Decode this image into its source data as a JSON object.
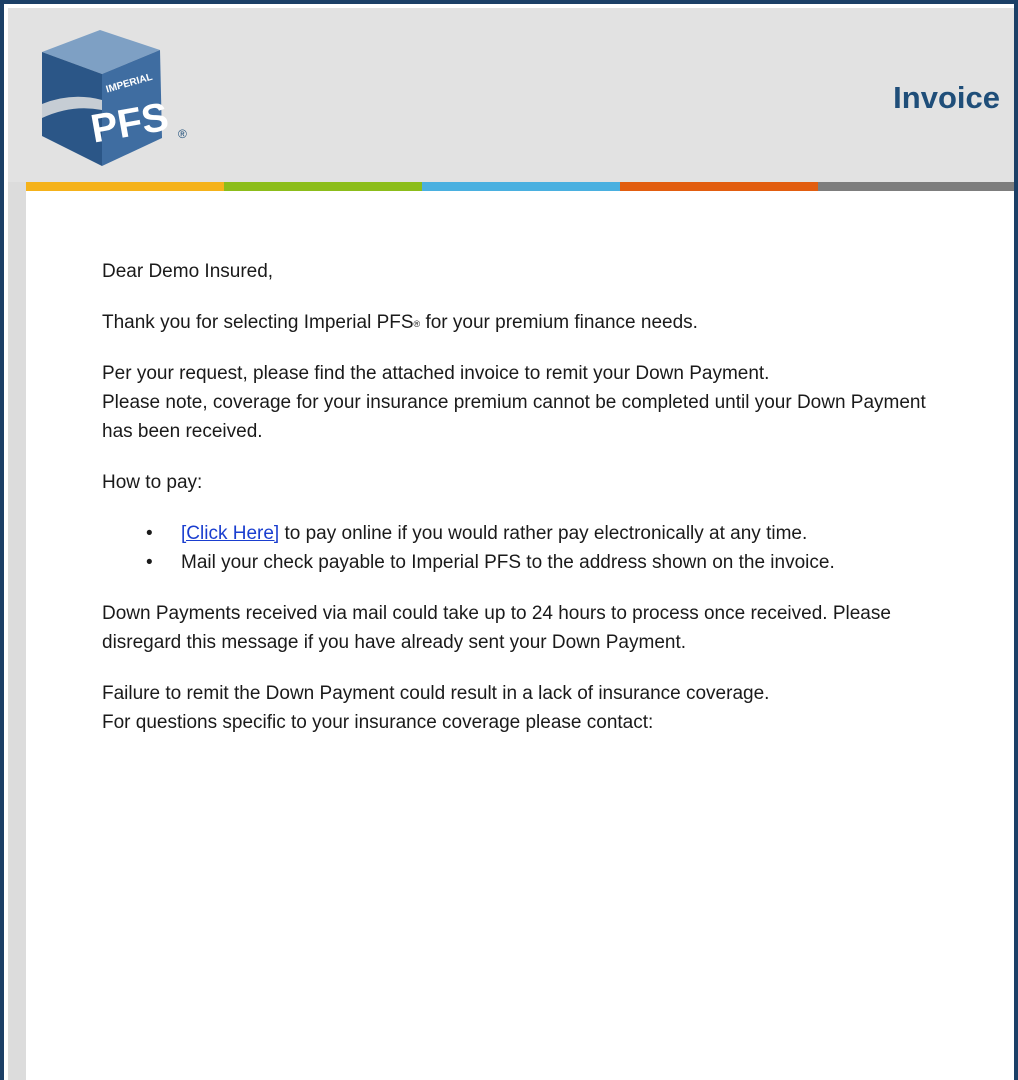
{
  "header": {
    "logo": {
      "top_text": "IMPERIAL",
      "main_text": "PFS",
      "registered_mark": "®"
    },
    "title": "Invoice"
  },
  "colors": {
    "frame_border": "#1b3f66",
    "header_bg": "#e2e2e2",
    "title": "#1f4e79",
    "link": "#1a3ecf",
    "stripe": [
      "#f5b21a",
      "#8cbd1a",
      "#4ab0e0",
      "#e25d0f",
      "#7d7d7d"
    ]
  },
  "email": {
    "greeting": "Dear Demo Insured,",
    "thanks_before": "Thank you for selecting Imperial PFS",
    "thanks_mark": "®",
    "thanks_after": " for your premium finance needs.",
    "request_line": "Per your request, please find the attached invoice to remit your Down Payment.",
    "note_line": "Please note, coverage for your insurance premium cannot be completed until your Down Payment has been received.",
    "how_to_pay": "How to pay:",
    "pay_options": [
      {
        "link_text": "[Click Here]",
        "text": " to pay online if you would rather pay electronically at any time."
      },
      {
        "link_text": "",
        "text": "Mail your check payable to Imperial PFS to the address shown on the invoice."
      }
    ],
    "mail_processing": "Down Payments received via mail could take up to 24 hours to process once received. Please disregard this message if you have already sent your Down Payment.",
    "failure_warning": "Failure to remit the Down Payment could result in a lack of insurance coverage.",
    "contact_prompt": "For questions specific to your insurance coverage please contact:"
  }
}
